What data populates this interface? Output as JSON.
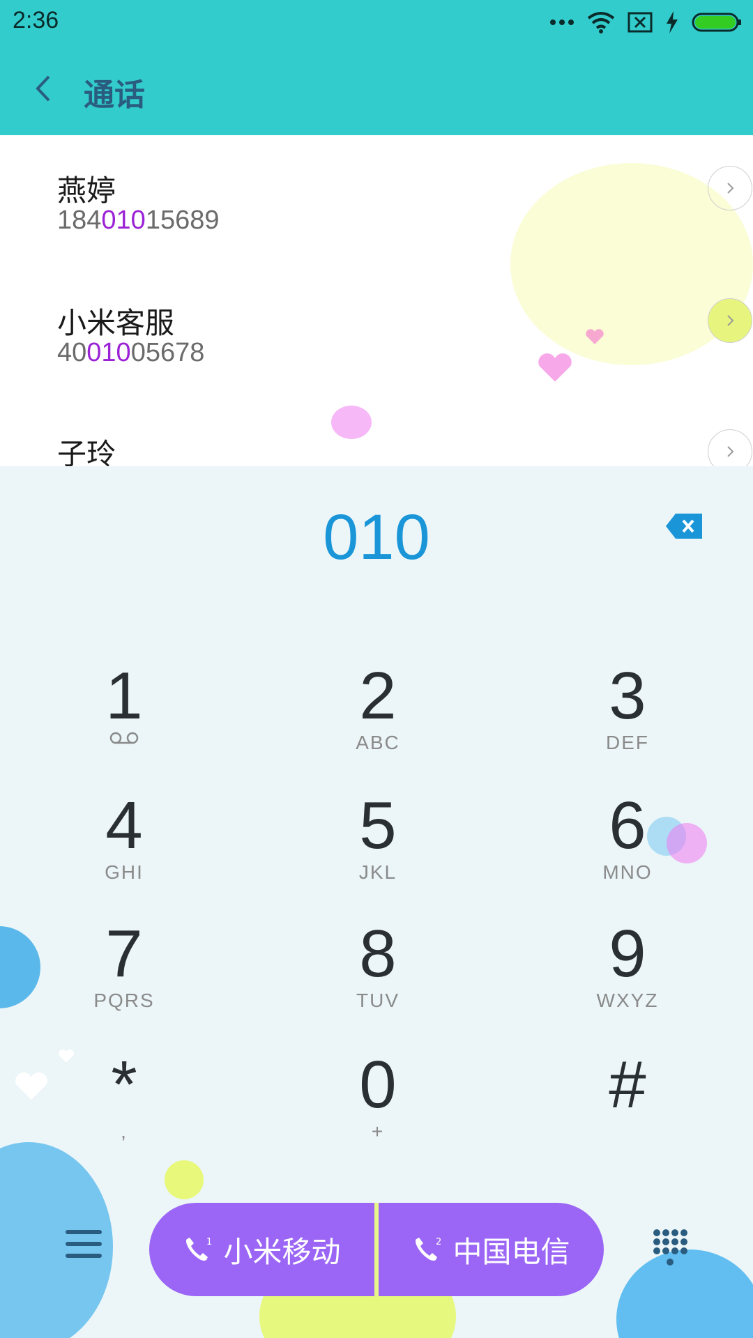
{
  "status_bar": {
    "time": "2:36",
    "icons": [
      "more-dots-icon",
      "wifi-icon",
      "sim-missing-icon",
      "charging-icon",
      "battery-icon"
    ]
  },
  "header": {
    "title": "通话",
    "back_icon": "back-arrow-icon"
  },
  "contacts": [
    {
      "name": "燕婷",
      "num_pre": "184",
      "num_hl": "010",
      "num_post": "15689"
    },
    {
      "name": "小米客服",
      "num_pre": "40",
      "num_hl": "010",
      "num_post": "05678"
    },
    {
      "name": "子玲",
      "num_pre": "",
      "num_hl": "",
      "num_post": ""
    }
  ],
  "dialer": {
    "input": "010",
    "keys": [
      {
        "digit": "1",
        "letters": ""
      },
      {
        "digit": "2",
        "letters": "ABC"
      },
      {
        "digit": "3",
        "letters": "DEF"
      },
      {
        "digit": "4",
        "letters": "GHI"
      },
      {
        "digit": "5",
        "letters": "JKL"
      },
      {
        "digit": "6",
        "letters": "MNO"
      },
      {
        "digit": "7",
        "letters": "PQRS"
      },
      {
        "digit": "8",
        "letters": "TUV"
      },
      {
        "digit": "9",
        "letters": "WXYZ"
      },
      {
        "digit": "*",
        "letters": ","
      },
      {
        "digit": "0",
        "letters": "+"
      },
      {
        "digit": "#",
        "letters": ""
      }
    ]
  },
  "call_buttons": [
    {
      "sim": "1",
      "label": "小米移动"
    },
    {
      "sim": "2",
      "label": "中国电信"
    }
  ],
  "colors": {
    "accent": "#33cccc",
    "number_highlight": "#9b22d6",
    "call_button": "#9b66f5",
    "dial_text": "#1a95d8"
  }
}
